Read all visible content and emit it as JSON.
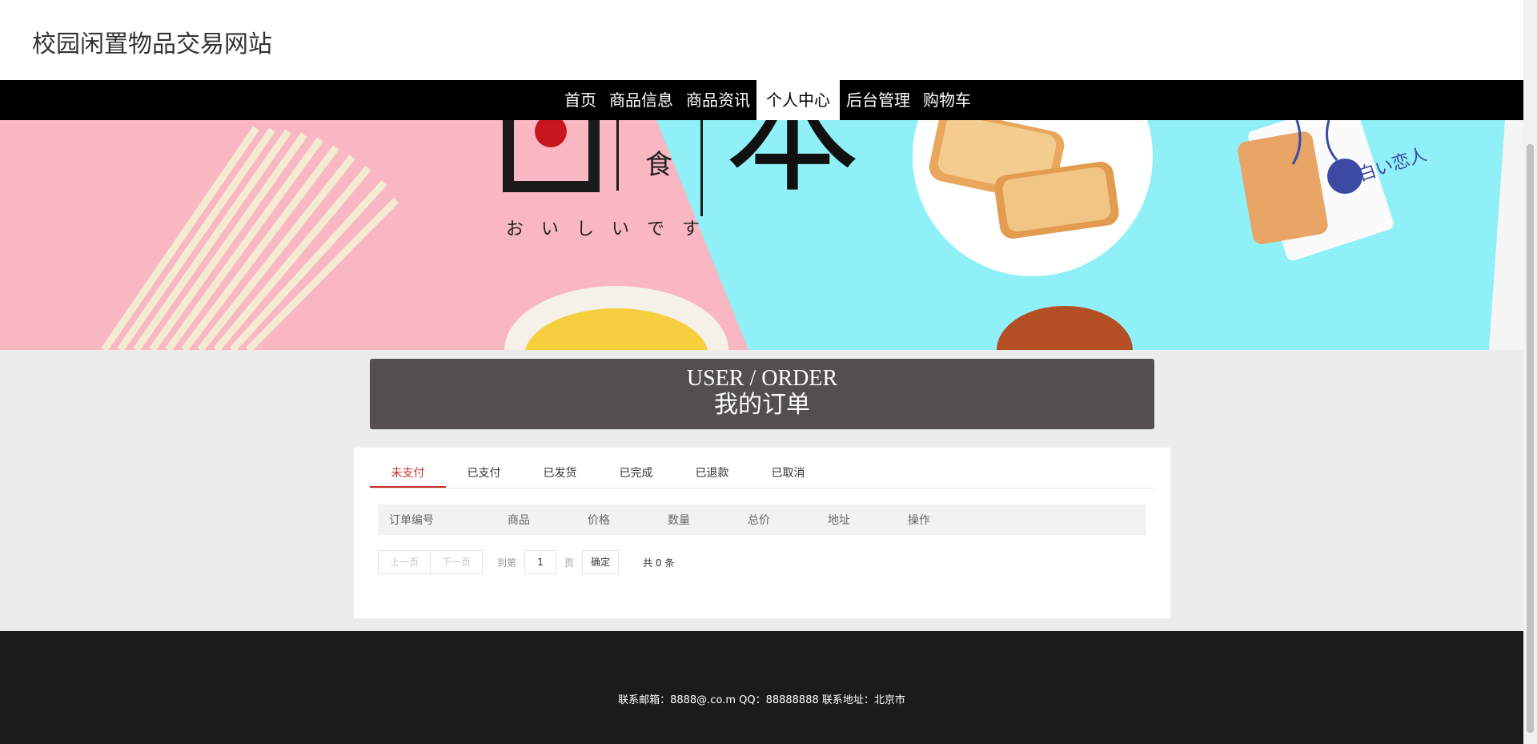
{
  "site": {
    "title": "校园闲置物品交易网站"
  },
  "nav": {
    "items": [
      {
        "label": "首页"
      },
      {
        "label": "商品信息"
      },
      {
        "label": "商品资讯"
      },
      {
        "label": "个人中心",
        "active": true
      },
      {
        "label": "后台管理"
      },
      {
        "label": "购物车"
      }
    ]
  },
  "banner": {
    "char_main": "本",
    "char_small": "食",
    "kana": "お　い　し　い　で　す",
    "package_text": "白い恋人",
    "colors": {
      "left": "#f9b7c3",
      "right": "#8ff1f7"
    }
  },
  "section": {
    "title_en": "USER / ORDER",
    "title_cn": "我的订单"
  },
  "tabs": [
    {
      "label": "未支付",
      "active": true
    },
    {
      "label": "已支付"
    },
    {
      "label": "已发货"
    },
    {
      "label": "已完成"
    },
    {
      "label": "已退款"
    },
    {
      "label": "已取消"
    }
  ],
  "table": {
    "columns": [
      "订单编号",
      "商品",
      "价格",
      "数量",
      "总价",
      "地址",
      "操作"
    ],
    "rows": []
  },
  "pager": {
    "prev": "上一页",
    "next": "下一页",
    "goto": "到第",
    "page_value": "1",
    "page_unit": "页",
    "confirm": "确定",
    "total": "共 0 条"
  },
  "footer": {
    "text": "联系邮箱：8888@.co.m QQ：88888888 联系地址：北京市"
  },
  "colors": {
    "accent": "#c9302c",
    "nav_bg": "#000000",
    "title_box": "#554e4e",
    "footer_bg": "#1b1b1b"
  }
}
